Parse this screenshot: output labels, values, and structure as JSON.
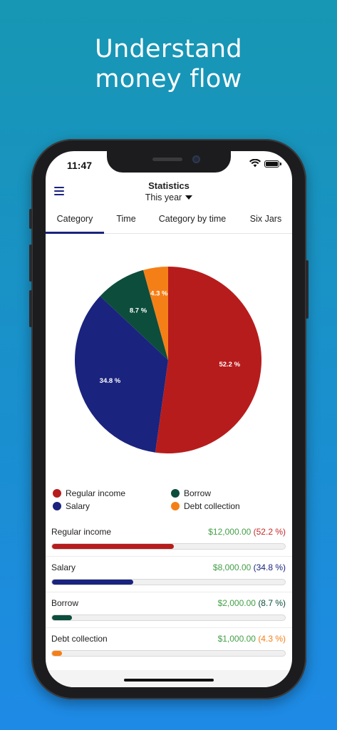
{
  "headline": {
    "line1": "Understand",
    "line2": "money flow"
  },
  "status_bar": {
    "time": "11:47"
  },
  "app_bar": {
    "title": "Statistics",
    "period": "This year"
  },
  "tabs": [
    {
      "label": "Category",
      "active": true
    },
    {
      "label": "Time",
      "active": false
    },
    {
      "label": "Category by time",
      "active": false
    },
    {
      "label": "Six Jars",
      "active": false
    }
  ],
  "chart_data": {
    "type": "pie",
    "slices": [
      {
        "name": "Regular income",
        "value": 52.2,
        "label": "52.2 %",
        "color": "#b71c1c"
      },
      {
        "name": "Salary",
        "value": 34.8,
        "label": "34.8 %",
        "color": "#1a237e"
      },
      {
        "name": "Borrow",
        "value": 8.7,
        "label": "8.7 %",
        "color": "#0d4d3c"
      },
      {
        "name": "Debt collection",
        "value": 4.3,
        "label": "4.3 %",
        "color": "#f57f17"
      }
    ],
    "legend_placement": "bottom"
  },
  "legend": [
    {
      "name": "Regular income",
      "color": "#b71c1c"
    },
    {
      "name": "Borrow",
      "color": "#0d4d3c"
    },
    {
      "name": "Salary",
      "color": "#1a237e"
    },
    {
      "name": "Debt collection",
      "color": "#f57f17"
    }
  ],
  "breakdown": [
    {
      "label": "Regular income",
      "amount": "$12,000.00",
      "percent": "(52.2 %)",
      "percent_color": "#c62828",
      "fraction": 0.522,
      "bar_color": "#b71c1c"
    },
    {
      "label": "Salary",
      "amount": "$8,000.00",
      "percent": "(34.8 %)",
      "percent_color": "#1a237e",
      "fraction": 0.348,
      "bar_color": "#1a237e"
    },
    {
      "label": "Borrow",
      "amount": "$2,000.00",
      "percent": "(8.7 %)",
      "percent_color": "#0d4d3c",
      "fraction": 0.087,
      "bar_color": "#0d4d3c"
    },
    {
      "label": "Debt collection",
      "amount": "$1,000.00",
      "percent": "(4.3 %)",
      "percent_color": "#f57f17",
      "fraction": 0.043,
      "bar_color": "#f57f17"
    }
  ],
  "colors": {
    "amount_green": "#43a047",
    "accent": "#1a237e"
  }
}
